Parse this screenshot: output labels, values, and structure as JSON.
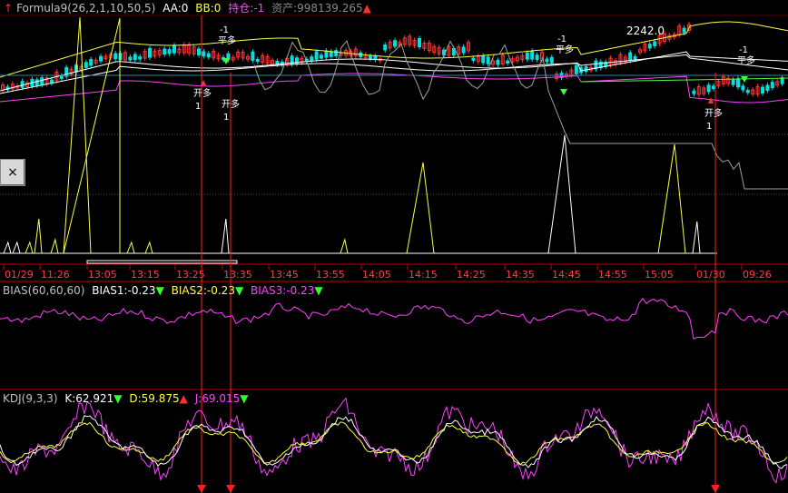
{
  "main_header": {
    "formula": "Formula9(26,2,1,10,50,5)",
    "aa": "AA:0",
    "bb": "BB:0",
    "position": "持仓:-1",
    "assets": "资产:998139.265"
  },
  "bias_header": {
    "title": "BIAS(60,60,60)",
    "bias1": "BIAS1:-0.23",
    "bias2": "BIAS2:-0.23",
    "bias3": "BIAS3:-0.23"
  },
  "kdj_header": {
    "title": "KDJ(9,3,3)",
    "k": "K:62.921",
    "d": "D:59.875",
    "j": "J:69.015"
  },
  "close_button": "×",
  "price_annotation": "2242.0",
  "signals": [
    {
      "label": "开多",
      "qty": "1"
    },
    {
      "label": "平多",
      "qty": "-1"
    },
    {
      "label": "开多",
      "qty": "1"
    },
    {
      "label": "平多",
      "qty": "-1"
    },
    {
      "label": "开多",
      "qty": "1"
    },
    {
      "label": "平多",
      "qty": "-1"
    }
  ],
  "chart_data": {
    "type": "line",
    "x_tick_labels": [
      "01/29",
      "11:26",
      "13:05",
      "13:15",
      "13:25",
      "13:35",
      "13:45",
      "13:55",
      "14:05",
      "14:15",
      "14:25",
      "14:35",
      "14:45",
      "14:55",
      "15:05",
      "01/30",
      "09:26"
    ],
    "panels": [
      "price",
      "BIAS",
      "KDJ"
    ],
    "colors": {
      "up": "#ff3030",
      "down": "#00e0e0",
      "white": "#ffffff",
      "yellow": "#ffff40",
      "magenta": "#ff40ff",
      "green": "#40ff40",
      "gray": "#a0a0a0",
      "axis": "#c00000"
    }
  }
}
